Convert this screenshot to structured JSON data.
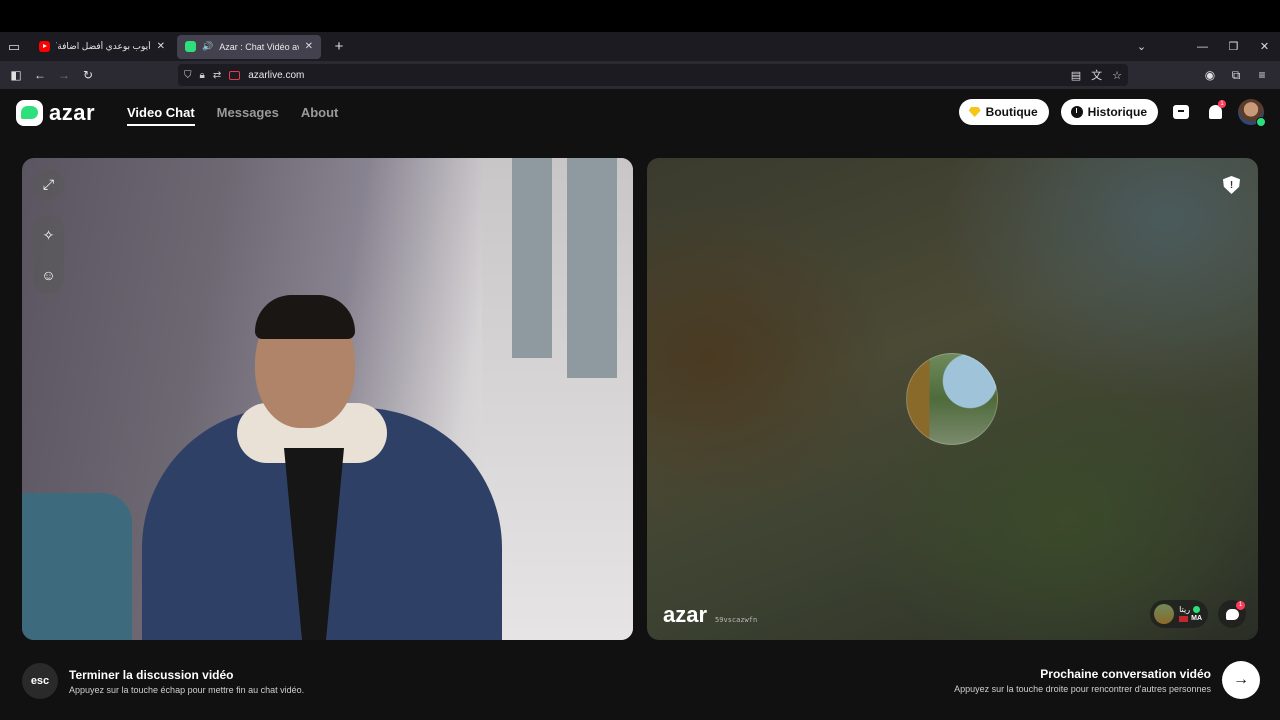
{
  "browser": {
    "tabs": [
      {
        "title": "أيوب بوعدي أفضل اضافة؟ عيسى",
        "favicon": "youtube-icon"
      },
      {
        "title": "Azar : Chat Vidéo avec de n",
        "favicon": "azar-icon",
        "audio": "speaker-icon"
      }
    ],
    "url": "azarlive.com",
    "new_tab_symbol": "+"
  },
  "app": {
    "logo": "azar",
    "nav": {
      "video_chat": "Video Chat",
      "messages": "Messages",
      "about": "About"
    },
    "header": {
      "boutique": "Boutique",
      "historique": "Historique",
      "notif_count": "1"
    },
    "peer": {
      "watermark_logo": "azar",
      "session_id": "59vscazwfn",
      "name": "ريتا",
      "country": "MA",
      "chat_badge": "1"
    },
    "footer": {
      "esc_key": "esc",
      "end_title": "Terminer la discussion vidéo",
      "end_subtitle": "Appuyez sur la touche échap pour mettre fin au chat vidéo.",
      "next_title": "Prochaine conversation vidéo",
      "next_subtitle": "Appuyez sur la touche droite pour rencontrer d'autres personnes",
      "next_arrow": "→"
    }
  },
  "colors": {
    "brand": "#2ee07b",
    "badge": "#ff3b5c",
    "background": "#111111"
  }
}
